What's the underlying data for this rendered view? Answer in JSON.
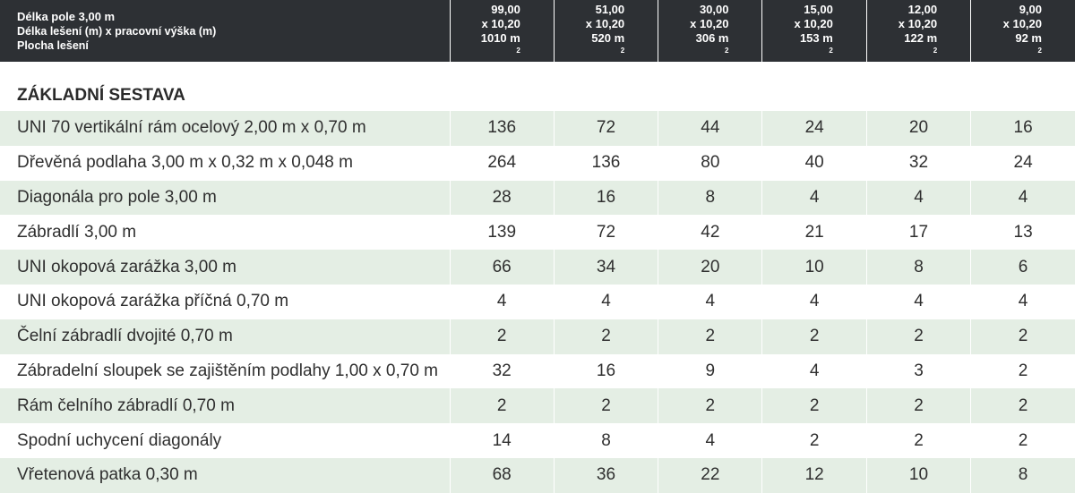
{
  "header": {
    "line1": "Délka pole 3,00 m",
    "line2": "Délka lešení (m) x pracovní výška (m)",
    "line3": "Plocha lešení",
    "columns": [
      {
        "length": "99,00",
        "height": "x 10,20",
        "area": "1010 m",
        "area_sup": "2"
      },
      {
        "length": "51,00",
        "height": "x 10,20",
        "area": "520 m",
        "area_sup": "2"
      },
      {
        "length": "30,00",
        "height": "x 10,20",
        "area": "306 m",
        "area_sup": "2"
      },
      {
        "length": "15,00",
        "height": "x 10,20",
        "area": "153 m",
        "area_sup": "2"
      },
      {
        "length": "12,00",
        "height": "x 10,20",
        "area": "122 m",
        "area_sup": "2"
      },
      {
        "length": "9,00",
        "height": "x 10,20",
        "area": "92 m",
        "area_sup": "2"
      }
    ]
  },
  "section": {
    "title": "ZÁKLADNÍ SESTAVA"
  },
  "rows": [
    {
      "label": "UNI 70 vertikální rám ocelový 2,00 m x 0,70 m",
      "values": [
        "136",
        "72",
        "44",
        "24",
        "20",
        "16"
      ]
    },
    {
      "label": "Dřevěná podlaha 3,00 m x 0,32 m x 0,048 m",
      "values": [
        "264",
        "136",
        "80",
        "40",
        "32",
        "24"
      ]
    },
    {
      "label": "Diagonála pro pole 3,00 m",
      "values": [
        "28",
        "16",
        "8",
        "4",
        "4",
        "4"
      ]
    },
    {
      "label": "Zábradlí 3,00 m",
      "values": [
        "139",
        "72",
        "42",
        "21",
        "17",
        "13"
      ]
    },
    {
      "label": "UNI okopová zarážka 3,00 m",
      "values": [
        "66",
        "34",
        "20",
        "10",
        "8",
        "6"
      ]
    },
    {
      "label": "UNI okopová zarážka příčná 0,70 m",
      "values": [
        "4",
        "4",
        "4",
        "4",
        "4",
        "4"
      ]
    },
    {
      "label": "Čelní zábradlí dvojité 0,70 m",
      "values": [
        "2",
        "2",
        "2",
        "2",
        "2",
        "2"
      ]
    },
    {
      "label": "Zábradelní sloupek se zajištěním podlahy 1,00 x 0,70 m",
      "values": [
        "32",
        "16",
        "9",
        "4",
        "3",
        "2"
      ]
    },
    {
      "label": "Rám čelního zábradlí 0,70 m",
      "values": [
        "2",
        "2",
        "2",
        "2",
        "2",
        "2"
      ]
    },
    {
      "label": "Spodní uchycení diagonály",
      "values": [
        "14",
        "8",
        "4",
        "2",
        "2",
        "2"
      ]
    },
    {
      "label": "Vřetenová patka 0,30 m",
      "values": [
        "68",
        "36",
        "22",
        "12",
        "10",
        "8"
      ]
    }
  ],
  "colors": {
    "header_bg": "#2d3034",
    "shaded_row_bg": "#e4eee4",
    "text": "#2f2f2f"
  }
}
